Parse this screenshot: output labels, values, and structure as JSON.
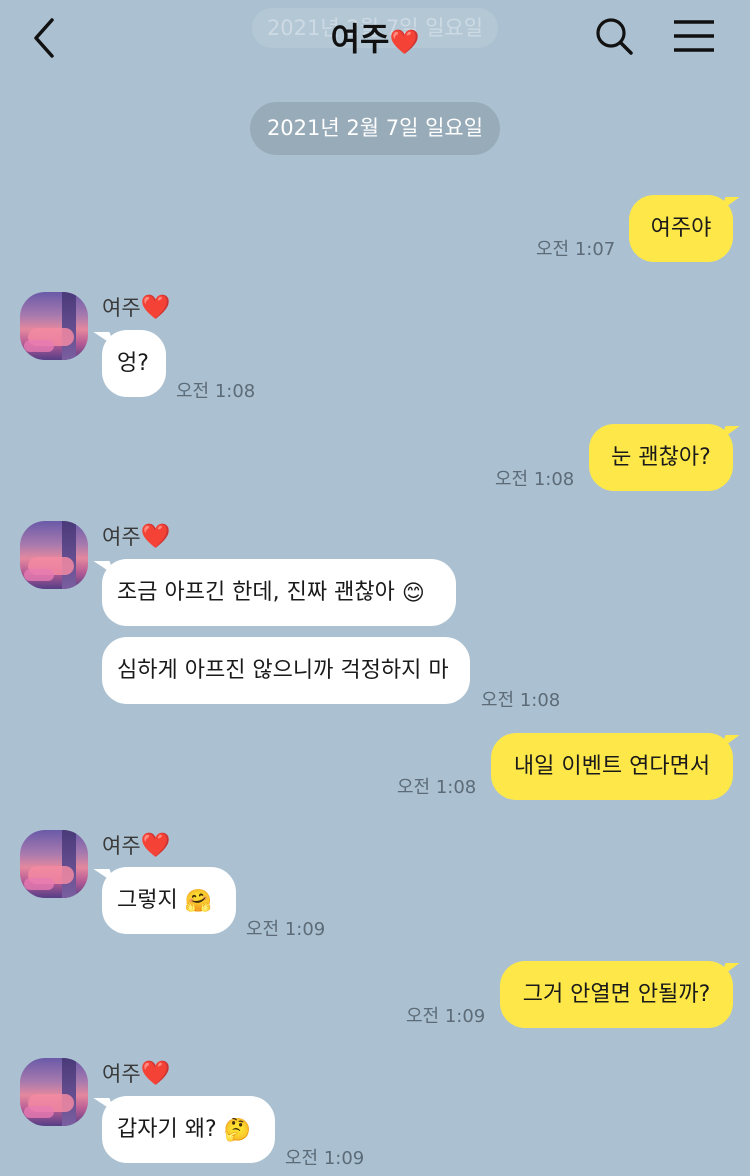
{
  "header": {
    "title": "여주",
    "heart": "❤️",
    "ghost_date": "2021년 2월 7일 일요일",
    "back_icon": "chevron-left-icon",
    "search_icon": "search-icon",
    "menu_icon": "hamburger-menu-icon"
  },
  "date_divider": "2021년 2월 7일 일요일",
  "sender": {
    "name": "여주",
    "heart": "❤️"
  },
  "messages": [
    {
      "text": "여주야",
      "time": "오전 1:07"
    },
    {
      "text": "엉?",
      "time": "오전 1:08"
    },
    {
      "text": "눈 괜찮아?",
      "time": "오전 1:08"
    },
    {
      "text": "조금 아프긴 한데, 진짜 괜찮아",
      "emoji": "😊"
    },
    {
      "text": "심하게 아프진 않으니까 걱정하지 마",
      "time": "오전 1:08"
    },
    {
      "text": "내일 이벤트 연다면서",
      "time": "오전 1:08"
    },
    {
      "text": "그렇지",
      "emoji": "🤗",
      "time": "오전 1:09"
    },
    {
      "text": "그거 안열면 안될까?",
      "time": "오전 1:09"
    },
    {
      "text": "갑자기 왜?",
      "emoji": "🤔",
      "time": "오전 1:09"
    }
  ],
  "colors": {
    "background": "#abc1d1",
    "outgoing_bubble": "#fee849",
    "incoming_bubble": "#ffffff",
    "date_pill": "#98abb9"
  }
}
